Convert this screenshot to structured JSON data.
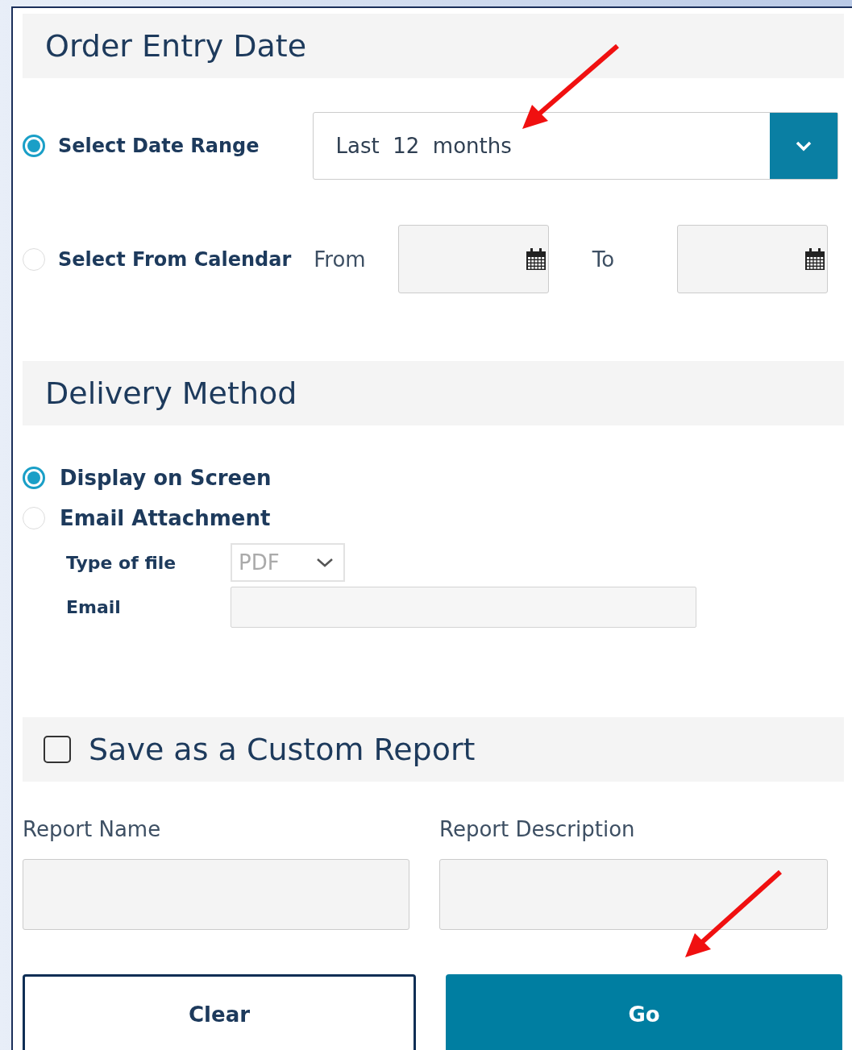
{
  "date_section": {
    "title": "Order Entry Date",
    "range_option": {
      "label": "Select Date Range",
      "selected": true
    },
    "range_select": {
      "value": "Last  12  months"
    },
    "calendar_option": {
      "label": "Select From Calendar",
      "selected": false
    },
    "from_label": "From",
    "to_label": "To"
  },
  "delivery_section": {
    "title": "Delivery Method",
    "options": [
      {
        "label": "Display on Screen",
        "selected": true
      },
      {
        "label": "Email Attachment",
        "selected": false
      }
    ],
    "file_type_label": "Type of file",
    "file_type": {
      "value": "PDF",
      "disabled": true
    },
    "email_label": "Email"
  },
  "custom_report": {
    "title": "Save as a Custom Report",
    "checked": false,
    "name_label": "Report Name",
    "description_label": "Report Description"
  },
  "buttons": [
    {
      "label": "Clear",
      "kind": "secondary"
    },
    {
      "label": "Go",
      "kind": "primary"
    }
  ]
}
